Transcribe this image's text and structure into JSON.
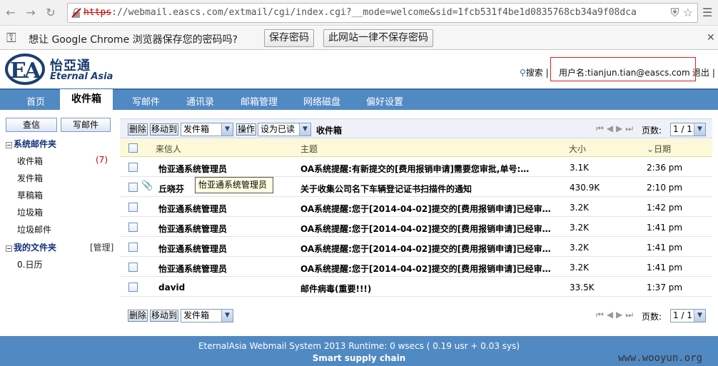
{
  "browser": {
    "url_scheme": "https",
    "url_rest": "://webmail.eascs.com/extmail/cgi/index.cgi?__mode=welcome&sid=1fcb531f4be1d0835768cb34a9f08dca",
    "infobar_text": "想让 Google Chrome 浏览器保存您的密码吗?",
    "save_password_label": "保存密码",
    "never_save_label": "此网站一律不保存密码"
  },
  "header": {
    "logo_cn": "怡亞通",
    "logo_en": "Eternal Asia",
    "search_label": "搜索",
    "user_label": "用户名:tianjun.tian@eascs.com",
    "logout_label": "退出"
  },
  "nav": {
    "items": [
      "首页",
      "收件箱",
      "写邮件",
      "通讯录",
      "邮箱管理",
      "网络磁盘",
      "偏好设置"
    ]
  },
  "sidebar": {
    "check_label": "查信",
    "compose_label": "写邮件",
    "system_folders_label": "系统邮件夹",
    "folders": [
      "收件箱",
      "发件箱",
      "草稿箱",
      "垃圾箱",
      "垃圾邮件"
    ],
    "inbox_unread": "(7)",
    "my_folders_label": "我的文件夹",
    "manage_label": "[管理]",
    "my_folders": [
      "0.日历"
    ]
  },
  "toolbar": {
    "delete_label": "删除",
    "move_label": "移动到",
    "move_target": "发件箱",
    "action_label": "操作",
    "mark_as": "设为已读",
    "folder_title": "收件箱",
    "pages_label": "页数:",
    "page_value": "1 / 1"
  },
  "columns": {
    "from": "来信人",
    "subject": "主题",
    "size": "大小",
    "date": "日期"
  },
  "messages": [
    {
      "from": "怡亚通系统管理员",
      "subject": "OA系统提醒:有新提交的[费用报销申请]需要您审批,单号:…",
      "size": "3.1K",
      "date": "2:36 pm",
      "unread": true,
      "attachment": false
    },
    {
      "from": "丘晓芬",
      "subject": "关于收集公司名下车辆登记证书扫描件的通知",
      "size": "430.9K",
      "date": "2:10 pm",
      "unread": true,
      "attachment": true
    },
    {
      "from": "怡亚通系统管理员",
      "subject": "OA系统提醒:您于[2014-04-02]提交的[费用报销申请]已经审…",
      "size": "3.2K",
      "date": "1:42 pm",
      "unread": true,
      "attachment": false
    },
    {
      "from": "怡亚通系统管理员",
      "subject": "OA系统提醒:您于[2014-04-02]提交的[费用报销申请]已经审…",
      "size": "3.2K",
      "date": "1:41 pm",
      "unread": true,
      "attachment": false
    },
    {
      "from": "怡亚通系统管理员",
      "subject": "OA系统提醒:您于[2014-04-02]提交的[费用报销申请]已经审…",
      "size": "3.2K",
      "date": "1:41 pm",
      "unread": true,
      "attachment": false
    },
    {
      "from": "怡亚通系统管理员",
      "subject": "OA系统提醒:您于[2014-04-02]提交的[费用报销申请]已经审…",
      "size": "3.2K",
      "date": "1:41 pm",
      "unread": true,
      "attachment": false
    },
    {
      "from": "david",
      "subject": "邮件病毒(重要!!!)",
      "size": "33.5K",
      "date": "1:37 pm",
      "unread": true,
      "attachment": false
    }
  ],
  "tooltip": "怡亚通系统管理员",
  "footer": {
    "line1": "EternalAsia Webmail System 2013 Runtime: 0 wsecs ( 0.19 usr + 0.03 sys)",
    "line2": "Smart supply chain"
  },
  "watermark": "www.wooyun.org",
  "colors": {
    "nav_bar": "#5189c3",
    "user_box_border": "#dd2222",
    "grid_header": "#fcf8d8"
  }
}
